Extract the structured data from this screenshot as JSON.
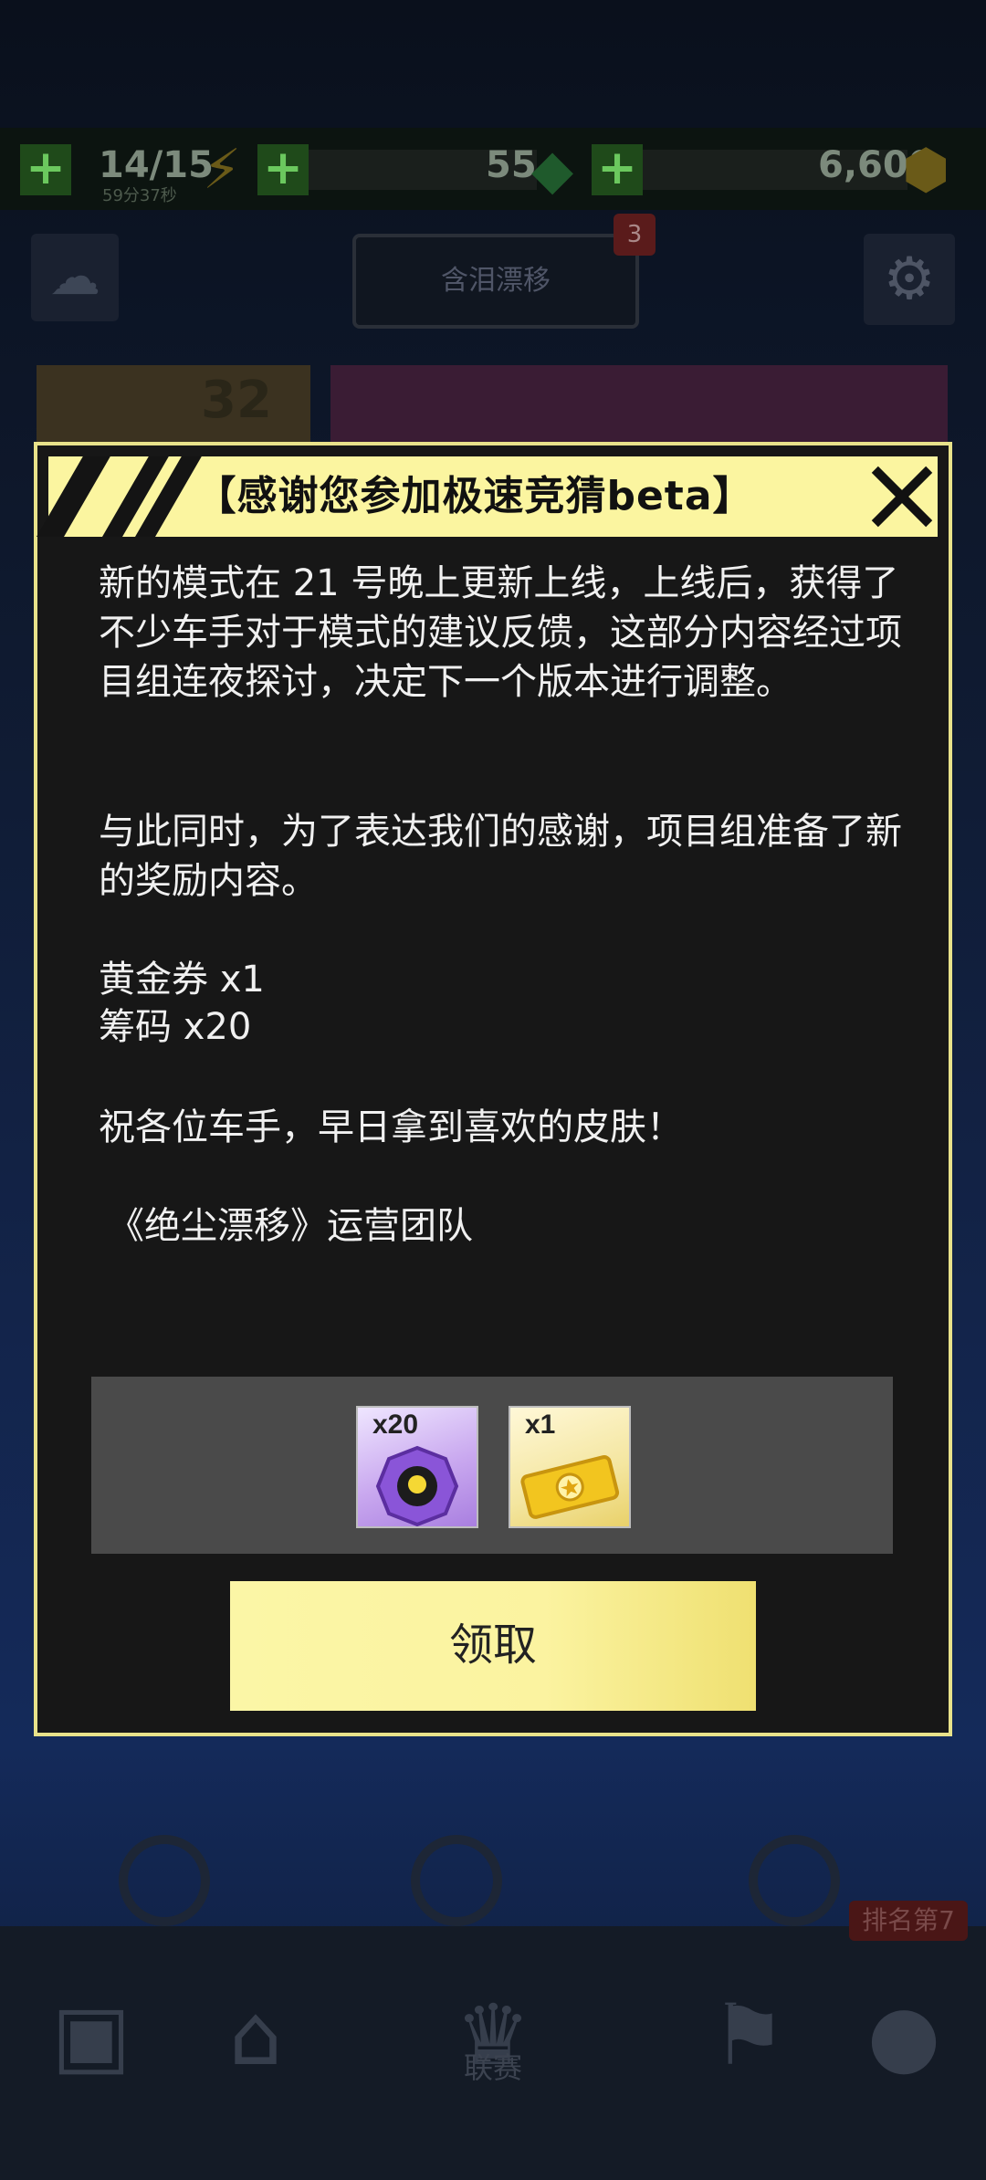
{
  "status_bar": {
    "fuel": "14/15",
    "fuel_timer": "59分37秒",
    "gems": "55",
    "coins": "6,600"
  },
  "top": {
    "banner_label": "含泪漂移",
    "banner_notifications": "3",
    "league_points": "32"
  },
  "bottom_nav": {
    "league_label": "联赛",
    "rank_badge": "排名第7"
  },
  "dialog": {
    "title": "【感谢您参加极速竞猜beta】",
    "paragraphs": {
      "p1": "新的模式在 21 号晚上更新上线，上线后，获得了不少车手对于模式的建议反馈，这部分内容经过项目组连夜探讨，决定下一个版本进行调整。",
      "p2": "与此同时，为了表达我们的感谢，项目组准备了新的奖励内容。",
      "reward_line_1": "黄金券 x1",
      "reward_line_2": "筹码 x20",
      "p3": "祝各位车手，早日拿到喜欢的皮肤！",
      "signature": "《绝尘漂移》运营团队"
    },
    "rewards": [
      {
        "qty": "x20",
        "icon": "chip-icon"
      },
      {
        "qty": "x1",
        "icon": "gold-ticket-icon"
      }
    ],
    "claim_label": "领取"
  }
}
